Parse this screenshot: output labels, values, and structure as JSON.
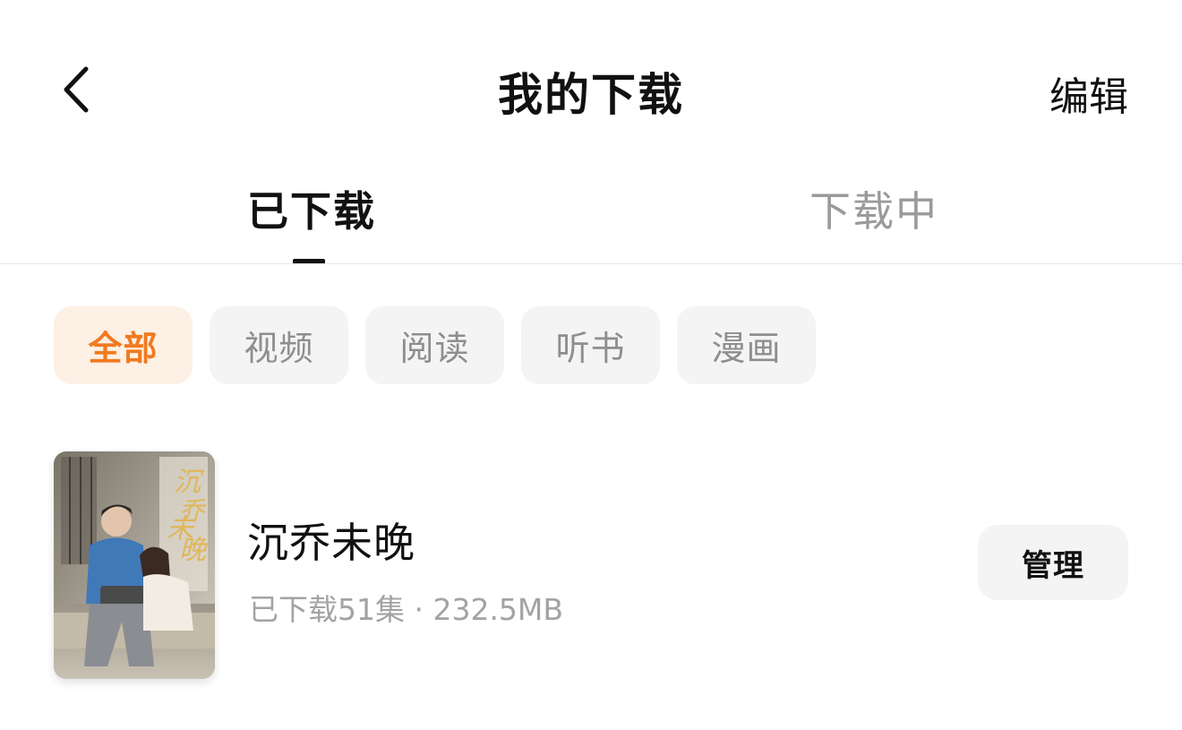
{
  "header": {
    "title": "我的下载",
    "edit_label": "编辑",
    "back_icon": "chevron-left-icon"
  },
  "tabs": [
    {
      "label": "已下载",
      "active": true
    },
    {
      "label": "下载中",
      "active": false
    }
  ],
  "filters": [
    {
      "label": "全部",
      "active": true
    },
    {
      "label": "视频",
      "active": false
    },
    {
      "label": "阅读",
      "active": false
    },
    {
      "label": "听书",
      "active": false
    },
    {
      "label": "漫画",
      "active": false
    }
  ],
  "downloads": [
    {
      "title": "沉乔未晚",
      "meta": "已下载51集 · 232.5MB",
      "manage_label": "管理",
      "cover_title": "沉乔未晚"
    }
  ],
  "colors": {
    "accent": "#f07a20",
    "accent_bg": "#fdf0e4",
    "chip_bg": "#f4f4f4",
    "muted_text": "#9a9a9a"
  }
}
